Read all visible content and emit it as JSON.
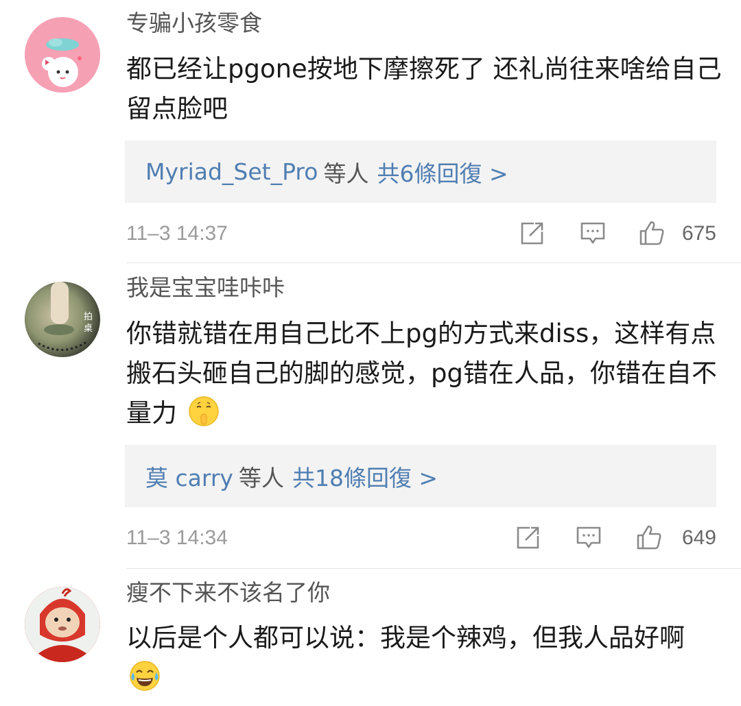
{
  "comments": [
    {
      "username": "专骗小孩零食",
      "text": "都已经让pgone按地下摩擦死了 还礼尚往来啥给自己留点脸吧",
      "emoji": "",
      "reply_name": "Myriad_Set_Pro",
      "reply_others": "等人",
      "reply_count": "共6條回復 >",
      "time": "11–3 14:37",
      "likes": "675",
      "avatar_icon": "cartoon-girl-avatar-icon"
    },
    {
      "username": "我是宝宝哇咔咔",
      "text": "你错就错在用自己比不上pg的方式来diss，这样有点搬石头砸自己的脚的感觉，pg错在人品，你错在自不量力",
      "emoji": "🤫",
      "reply_name": "莫 carry",
      "reply_others": "等人",
      "reply_count": "共18條回復 >",
      "time": "11–3 14:34",
      "likes": "649",
      "avatar_icon": "photo-avatar-icon"
    },
    {
      "username": "瘦不下来不该名了你",
      "text": "以后是个人都可以说：我是个辣鸡，但我人品好啊",
      "emoji": "😂",
      "avatar_icon": "teletubby-avatar-icon"
    }
  ],
  "avatar_overlay_text": "拍桌",
  "colors": {
    "link": "#4f7eb2",
    "username": "#555555",
    "meta": "#9a9a9a",
    "reply_bg": "#f3f3f3"
  }
}
